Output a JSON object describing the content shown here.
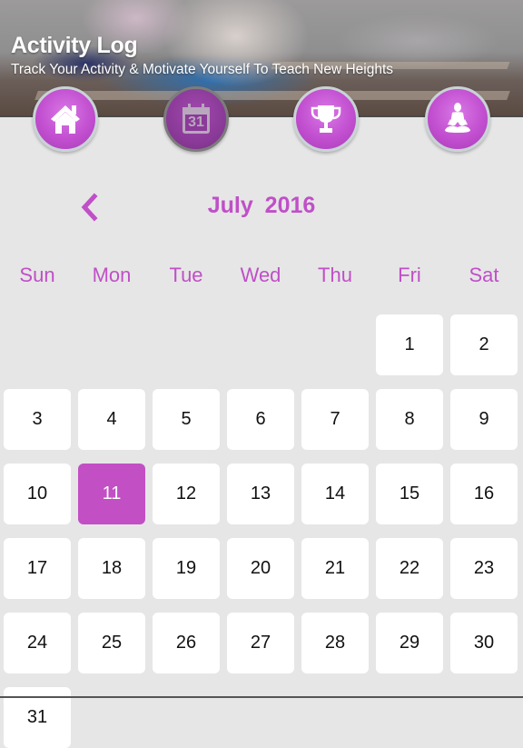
{
  "header": {
    "title": "Activity Log",
    "subtitle": "Track Your Activity & Motivate Yourself To Teach New Heights"
  },
  "nav": [
    {
      "name": "home",
      "icon": "home-icon",
      "active": false
    },
    {
      "name": "calendar",
      "icon": "calendar-icon",
      "icon_text": "31",
      "active": true
    },
    {
      "name": "trophy",
      "icon": "trophy-icon",
      "active": false
    },
    {
      "name": "yoga",
      "icon": "meditation-icon",
      "active": false
    }
  ],
  "calendar": {
    "month_label": "July  2016",
    "prev_icon": "chevron-left-icon",
    "weekdays": [
      "Sun",
      "Mon",
      "Tue",
      "Wed",
      "Thu",
      "Fri",
      "Sat"
    ],
    "first_weekday_index": 5,
    "days_visible": [
      1,
      2,
      3,
      4,
      5,
      6,
      7,
      8,
      9,
      10,
      11,
      12,
      13,
      14,
      15,
      16,
      17,
      18,
      19,
      20,
      21,
      22,
      23,
      24,
      25,
      26,
      27,
      28,
      29,
      30,
      31
    ],
    "selected_day": 11
  },
  "colors": {
    "accent": "#c04fc8",
    "selected_day_bg": "#c24fc4",
    "page_bg": "#e6e6e6"
  }
}
